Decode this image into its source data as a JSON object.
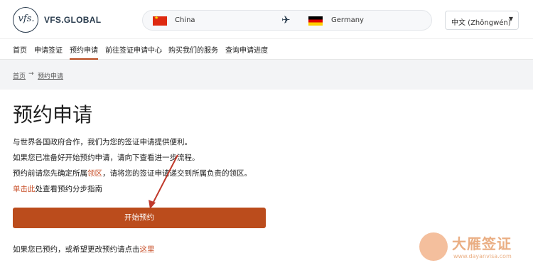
{
  "header": {
    "brand": "VFS.GLOBAL",
    "route": {
      "from": "China",
      "to": "Germany"
    },
    "language": "中文 (Zhōngwén)"
  },
  "nav": {
    "items": [
      "首页",
      "申请签证",
      "预约申请",
      "前往签证申请中心",
      "购买我们的服务",
      "查询申请进度"
    ],
    "active": "预约申请"
  },
  "breadcrumb": {
    "home": "首页",
    "separator": "→",
    "current": "预约申请"
  },
  "main": {
    "title": "预约申请",
    "line1": "与世界各国政府合作，我们为您的签证申请提供便利。",
    "line2": "如果您已准备好开始预约申请，请向下查看进一步流程。",
    "line3_before": "预约前请您先确定所属",
    "line3_link": "领区",
    "line3_after": "，请将您的签证申请递交到所属负责的领区。",
    "line4_link": "单击此",
    "line4_after": "处查看预约分步指南",
    "start_button": "开始预约",
    "footer_before": "如果您已预约，或希望更改预约请点击",
    "footer_link": "这里"
  },
  "watermark": {
    "title": "大雁签证",
    "url": "www.dayanvisa.com"
  },
  "colors": {
    "accent": "#bb4c1c",
    "link": "#c8502a",
    "brand": "#2a3c4e"
  }
}
